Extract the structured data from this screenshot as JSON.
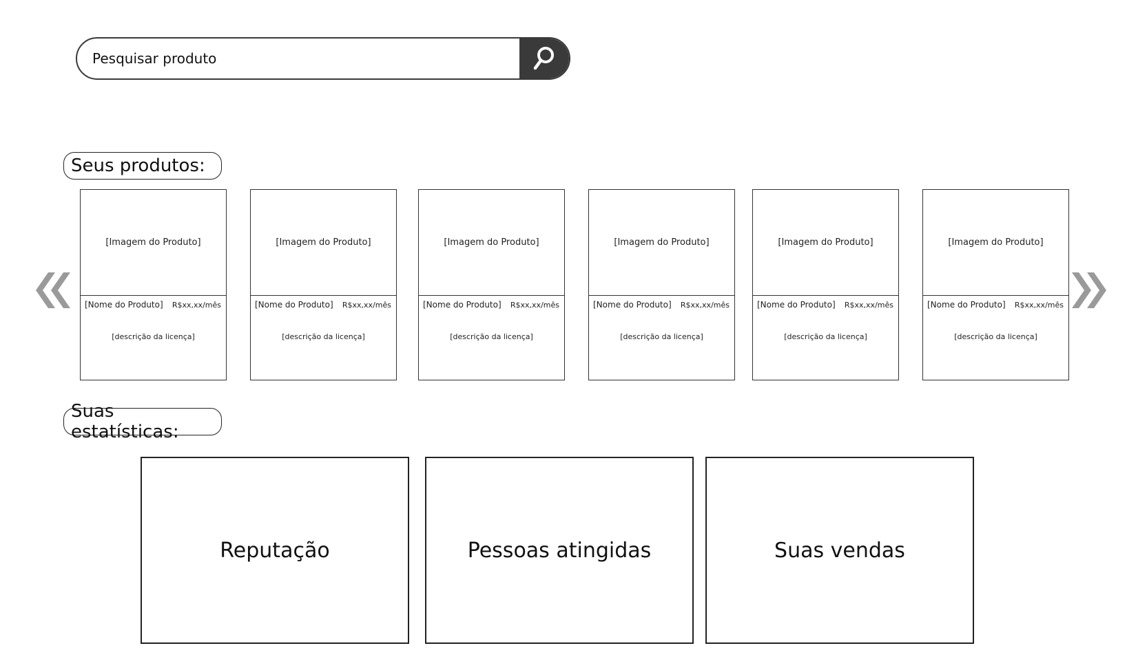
{
  "search": {
    "placeholder": "Pesquisar produto"
  },
  "icons": {
    "search": "search-icon",
    "prev": "double-chevron-left-icon",
    "next": "double-chevron-right-icon"
  },
  "colors": {
    "search_button": "#3a3a3a",
    "arrow": "#9a9a9a",
    "border": "#222222"
  },
  "sections": {
    "products_label": "Seus produtos:",
    "stats_label": "Suas estatísticas:"
  },
  "products": [
    {
      "image": "[Imagem do Produto]",
      "name": "[Nome do Produto]",
      "price": "R$xx,xx/mês",
      "description": "[descrição da licença]"
    },
    {
      "image": "[Imagem do Produto]",
      "name": "[Nome do Produto]",
      "price": "R$xx,xx/mês",
      "description": "[descrição da licença]"
    },
    {
      "image": "[Imagem do Produto]",
      "name": "[Nome do Produto]",
      "price": "R$xx,xx/mês",
      "description": "[descrição da licença]"
    },
    {
      "image": "[Imagem do Produto]",
      "name": "[Nome do Produto]",
      "price": "R$xx,xx/mês",
      "description": "[descrição da licença]"
    },
    {
      "image": "[Imagem do Produto]",
      "name": "[Nome do Produto]",
      "price": "R$xx,xx/mês",
      "description": "[descrição da licença]"
    },
    {
      "image": "[Imagem do Produto]",
      "name": "[Nome do Produto]",
      "price": "R$xx,xx/mês",
      "description": "[descrição da licença]"
    }
  ],
  "stats": [
    {
      "label": "Reputação"
    },
    {
      "label": "Pessoas atingidas"
    },
    {
      "label": "Suas vendas"
    }
  ]
}
